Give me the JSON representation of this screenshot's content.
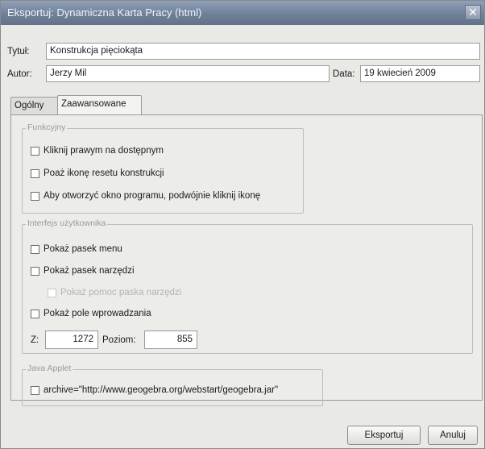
{
  "window": {
    "title": "Eksportuj: Dynamiczna Karta Pracy (html)",
    "close_glyph": "✕"
  },
  "meta": {
    "title_label": "Tytuł:",
    "title_value": "Konstrukcja pięciokąta",
    "author_label": "Autor:",
    "author_value": "Jerzy Mil",
    "date_label": "Data:",
    "date_value": "19 kwiecień 2009"
  },
  "tabs": [
    {
      "label": "Ogólny",
      "active": false
    },
    {
      "label": "Zaawansowane",
      "active": true
    }
  ],
  "functions": {
    "title": "Funkcyjny",
    "items": [
      {
        "label": "Kliknij prawym na dostępnym",
        "checked": false
      },
      {
        "label": "Poaż ikonę resetu konstrukcji",
        "checked": false
      },
      {
        "label": "Aby otworzyć okno programu, podwójnie kliknij  ikonę",
        "checked": false
      }
    ]
  },
  "ui": {
    "title": "Interfejs użytkownika",
    "items": [
      {
        "label": "Pokaż pasek menu",
        "checked": false
      },
      {
        "label": "Pokaż pasek narzędzi",
        "checked": false
      },
      {
        "label": "Pokaż pomoc paska narzędzi",
        "checked": false,
        "disabled": true
      },
      {
        "label": "Pokaż pole wprowadzania",
        "checked": false
      }
    ],
    "width_label": "Z:",
    "width_value": "1272",
    "height_label": "Poziom:",
    "height_value": "855"
  },
  "applet": {
    "title": "Java Applet",
    "items": [
      {
        "label": "archive=\"http://www.geogebra.org/webstart/geogebra.jar\"",
        "checked": false
      }
    ]
  },
  "buttons": {
    "export": "Eksportuj",
    "cancel": "Anuluj"
  },
  "colors": {
    "titlebar": "#6f8099",
    "dialog_bg": "#e9e9e5"
  }
}
